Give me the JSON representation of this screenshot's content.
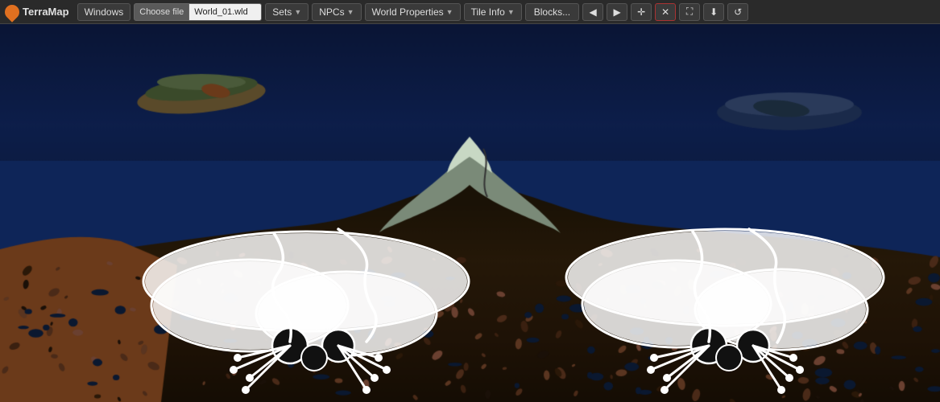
{
  "brand": {
    "name": "TerraMap",
    "icon": "map-icon"
  },
  "navbar": {
    "windows_label": "Windows",
    "choose_file_label": "Choose file",
    "file_name": "World_01.wld",
    "sets_label": "Sets",
    "npcs_label": "NPCs",
    "world_properties_label": "World Properties",
    "tile_info_label": "Tile Info",
    "blocks_label": "Blocks...",
    "btn_left": "◀",
    "btn_right": "▶",
    "btn_split": "⊕",
    "btn_close": "✕",
    "btn_expand": "⛶",
    "btn_download": "⬇",
    "btn_refresh": "↺"
  },
  "map": {
    "background_color": "#0d1b3e"
  }
}
